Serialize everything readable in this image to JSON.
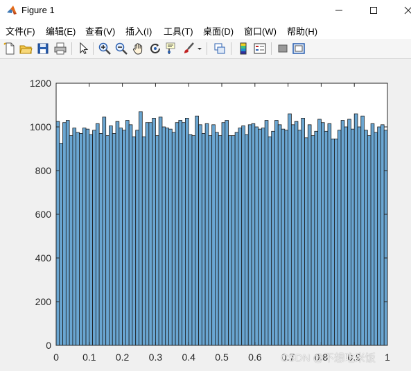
{
  "window": {
    "title": "Figure 1",
    "icon": "matlab-icon"
  },
  "menu": [
    "文件(F)",
    "编辑(E)",
    "查看(V)",
    "插入(I)",
    "工具(T)",
    "桌面(D)",
    "窗口(W)",
    "帮助(H)"
  ],
  "toolbar": [
    "new-figure-icon",
    "open-file-icon",
    "save-icon",
    "print-icon",
    "pointer-icon",
    "zoom-in-icon",
    "zoom-out-icon",
    "pan-icon",
    "rotate-3d-icon",
    "data-cursor-icon",
    "brush-icon",
    "link-plot-icon",
    "colorbar-icon",
    "legend-icon",
    "hide-plot-tools-icon",
    "show-plot-tools-icon"
  ],
  "colors": {
    "bar_fill": "#6aa6d2",
    "bar_edge": "#1a1a1a"
  },
  "watermark": "CSDN @不想吃米饭",
  "chart_data": {
    "type": "bar",
    "title": "",
    "xlabel": "",
    "ylabel": "",
    "xlim": [
      0,
      1
    ],
    "ylim": [
      0,
      1200
    ],
    "xticks": [
      0,
      0.1,
      0.2,
      0.3,
      0.4,
      0.5,
      0.6,
      0.7,
      0.8,
      0.9,
      1
    ],
    "xtick_labels": [
      "0",
      "0.1",
      "0.2",
      "0.3",
      "0.4",
      "0.5",
      "0.6",
      "0.7",
      "0.8",
      "0.9",
      "1"
    ],
    "yticks": [
      0,
      200,
      400,
      600,
      800,
      1000,
      1200
    ],
    "ytick_labels": [
      "0",
      "200",
      "400",
      "600",
      "800",
      "1000",
      "1200"
    ],
    "bin_width": 0.01,
    "values": [
      1025,
      925,
      1020,
      1030,
      960,
      995,
      975,
      970,
      995,
      990,
      965,
      985,
      1015,
      970,
      1045,
      960,
      1005,
      970,
      1025,
      995,
      985,
      1030,
      1010,
      955,
      985,
      1070,
      955,
      1020,
      1020,
      1040,
      960,
      1045,
      1000,
      995,
      990,
      975,
      1020,
      1030,
      1020,
      1040,
      965,
      960,
      1050,
      1010,
      970,
      1015,
      960,
      1010,
      975,
      960,
      1020,
      1030,
      960,
      960,
      975,
      995,
      1005,
      965,
      1010,
      1015,
      1000,
      990,
      995,
      1030,
      955,
      980,
      1030,
      1010,
      990,
      985,
      1060,
      1010,
      1025,
      985,
      1040,
      950,
      1010,
      960,
      980,
      1035,
      1020,
      980,
      1015,
      945,
      945,
      985,
      1030,
      1000,
      1035,
      990,
      1060,
      1000,
      1050,
      985,
      960,
      1015,
      975,
      1000,
      1010,
      985
    ]
  }
}
